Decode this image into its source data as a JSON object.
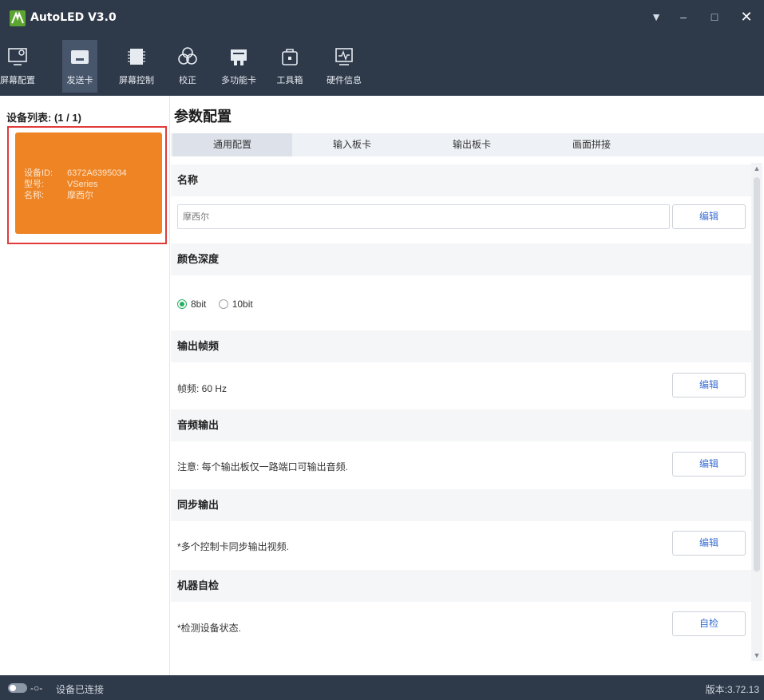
{
  "app": {
    "title": "AutoLED V3.0"
  },
  "window_controls": {
    "pin": "▼",
    "minimize": "–",
    "maximize": "□",
    "close": "✕"
  },
  "toolbar": {
    "items": [
      {
        "label": "屏幕配置",
        "icon": "monitor-gear-icon",
        "active": false
      },
      {
        "label": "发送卡",
        "icon": "sender-card-icon",
        "active": true
      },
      {
        "label": "屏幕控制",
        "icon": "chip-icon",
        "active": false
      },
      {
        "label": "校正",
        "icon": "calibration-icon",
        "active": false
      },
      {
        "label": "多功能卡",
        "icon": "multifunction-card-icon",
        "active": false
      },
      {
        "label": "工具箱",
        "icon": "toolbox-icon",
        "active": false
      },
      {
        "label": "硬件信息",
        "icon": "hardware-info-icon",
        "active": false
      }
    ]
  },
  "sidebar": {
    "header": "设备列表: (1 / 1)",
    "device": {
      "id_label": "设备ID:",
      "id_value": "6372A6395034",
      "model_label": "型号:",
      "model_value": "VSeries",
      "name_label": "名称:",
      "name_value": "摩西尔"
    }
  },
  "main": {
    "title": "参数配置",
    "tabs": [
      {
        "label": "通用配置",
        "active": true
      },
      {
        "label": "输入板卡",
        "active": false
      },
      {
        "label": "输出板卡",
        "active": false
      },
      {
        "label": "画面拼接",
        "active": false
      }
    ],
    "sections": {
      "name": {
        "header": "名称",
        "placeholder": "摩西尔",
        "edit": "编辑"
      },
      "color_depth": {
        "header": "颜色深度",
        "options": [
          {
            "label": "8bit",
            "checked": true
          },
          {
            "label": "10bit",
            "checked": false
          }
        ]
      },
      "frame_rate": {
        "header": "输出帧频",
        "text": "帧频: 60 Hz",
        "edit": "编辑"
      },
      "audio": {
        "header": "音频输出",
        "text": "注意: 每个输出板仅一路端口可输出音频.",
        "edit": "编辑"
      },
      "sync": {
        "header": "同步输出",
        "text": "*多个控制卡同步输出视频.",
        "edit": "编辑"
      },
      "self_test": {
        "header": "机器自检",
        "text": "*检测设备状态.",
        "button": "自检"
      }
    }
  },
  "status": {
    "connection_icon": "-○-",
    "text": "设备已连接",
    "version": "版本:3.72.13"
  },
  "colors": {
    "chrome": "#2e3949",
    "device_card": "#ee8424",
    "selection_border": "#e23a3a",
    "link_blue": "#3b6fd3",
    "radio_green": "#27ae60"
  }
}
